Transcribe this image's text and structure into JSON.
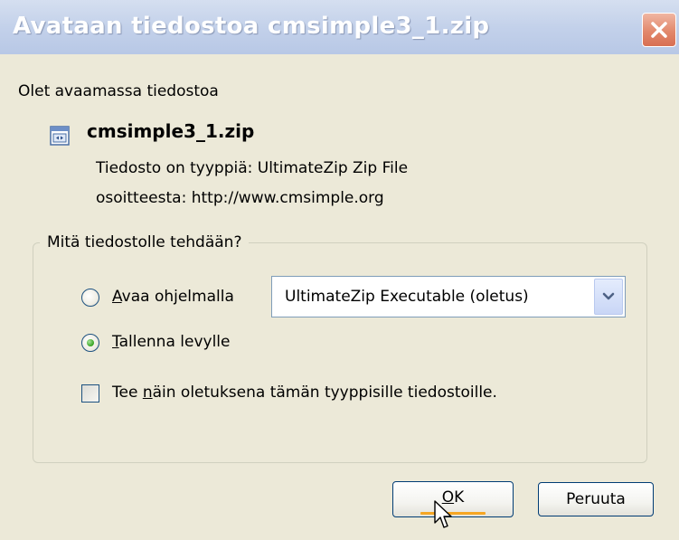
{
  "window": {
    "title": "Avataan tiedostoa cmsimple3_1.zip"
  },
  "file_info": {
    "intro": "Olet avaamassa tiedostoa",
    "filename": "cmsimple3_1.zip",
    "type_label": "Tiedosto on tyyppiä:",
    "type_value": "UltimateZip Zip File",
    "from_label": "osoitteesta:",
    "from_value": "http://www.cmsimple.org"
  },
  "action_group": {
    "legend": "Mitä tiedostolle tehdään?",
    "open_with": {
      "mnemonic": "A",
      "rest": "vaa ohjelmalla",
      "selected": false,
      "application": "UltimateZip Executable (oletus)"
    },
    "save": {
      "mnemonic": "T",
      "rest": "allenna levylle",
      "selected": true
    },
    "default_checkbox": {
      "before": "Tee ",
      "mnemonic": "n",
      "after": "äin oletuksena tämän tyyppisille tiedostoille.",
      "checked": false
    }
  },
  "buttons": {
    "ok_mnemonic": "O",
    "ok_rest": "K",
    "cancel": "Peruuta"
  },
  "icons": {
    "close": "close-icon",
    "file": "zip-file-icon",
    "dropdown": "chevron-down-icon",
    "cursor": "mouse-pointer-icon"
  },
  "colors": {
    "dialog_background": "#ece9d8",
    "title_text": "#ffffff",
    "close_button": "#e2886c",
    "radio_selected": "#35a31f",
    "default_button_focus": "#f6a623"
  }
}
